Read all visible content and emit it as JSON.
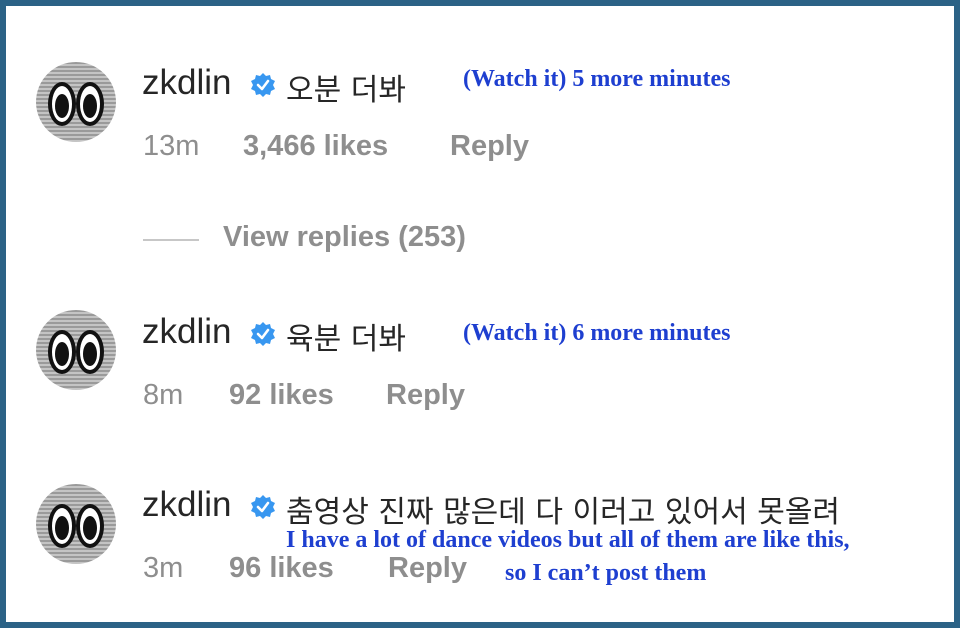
{
  "comments": [
    {
      "username": "zkdlin",
      "text": "오분 더봐",
      "translation": "(Watch it) 5 more minutes",
      "time": "13m",
      "likes": "3,466 likes",
      "reply": "Reply"
    },
    {
      "username": "zkdlin",
      "text": "육분 더봐",
      "translation": "(Watch it) 6 more minutes",
      "time": "8m",
      "likes": "92 likes",
      "reply": "Reply"
    },
    {
      "username": "zkdlin",
      "text": "춤영상 진짜 많은데 다 이러고 있어서 못올려",
      "translation_line1": "I have a lot of dance videos but all of them are like this,",
      "translation_line2": "so I can’t post them",
      "time": "3m",
      "likes": "96 likes",
      "reply": "Reply"
    }
  ],
  "view_replies": "View replies (253)",
  "colors": {
    "frame": "#2b6286",
    "translation": "#1e3fd0",
    "verified": "#3897f0",
    "muted": "#8e8e8e",
    "text": "#262626"
  },
  "icons": {
    "verified": "verified-badge-icon"
  }
}
